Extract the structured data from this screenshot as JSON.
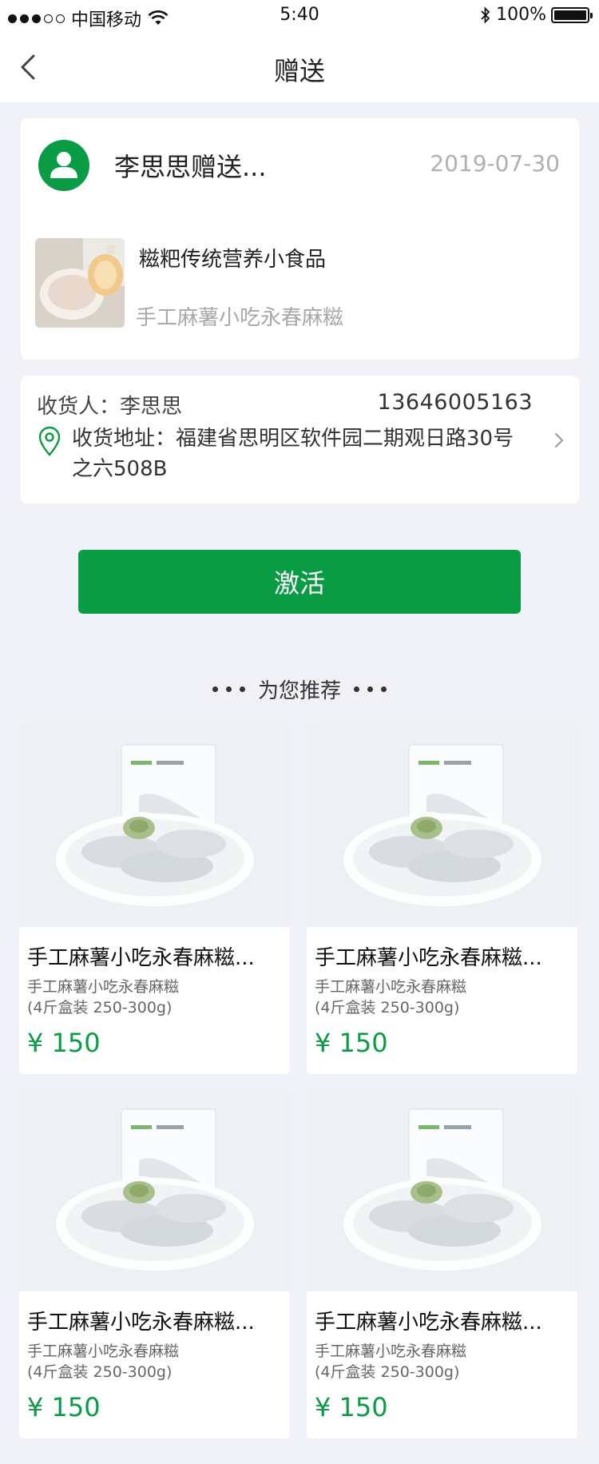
{
  "status_bar": {
    "carrier": "中国移动",
    "time": "5:40",
    "battery": "100%"
  },
  "nav": {
    "title": "赠送"
  },
  "gift": {
    "sender_text": "李思思赠送...",
    "date": "2019-07-30",
    "product_name": "糍粑传统营养小食品",
    "product_desc": "手工麻薯小吃永春麻糍"
  },
  "address": {
    "receiver": "收货人：李思思",
    "phone": "13646005163",
    "address_text": "收货地址：福建省思明区软件园二期观日路30号之六508B"
  },
  "actions": {
    "activate_label": "激活"
  },
  "recommend": {
    "heading": "为您推荐",
    "items": [
      {
        "title": "手工麻薯小吃永春麻糍...",
        "sub1": "手工麻薯小吃永春麻糍",
        "sub2": "(4斤盒装 250-300g)",
        "price": "¥ 150"
      },
      {
        "title": "手工麻薯小吃永春麻糍...",
        "sub1": "手工麻薯小吃永春麻糍",
        "sub2": "(4斤盒装 250-300g)",
        "price": "¥ 150"
      },
      {
        "title": "手工麻薯小吃永春麻糍...",
        "sub1": "手工麻薯小吃永春麻糍",
        "sub2": "(4斤盒装 250-300g)",
        "price": "¥ 150"
      },
      {
        "title": "手工麻薯小吃永春麻糍...",
        "sub1": "手工麻薯小吃永春麻糍",
        "sub2": "(4斤盒装 250-300g)",
        "price": "¥ 150"
      }
    ]
  },
  "icons": {
    "back": "chevron-left-icon",
    "wifi": "wifi-icon",
    "bluetooth": "bluetooth-icon",
    "battery": "battery-icon",
    "avatar": "user-icon",
    "location": "location-pin-icon",
    "chevron_right": "chevron-right-icon"
  },
  "colors": {
    "accent": "#0a9b45",
    "page_background": "#f1f2f7",
    "muted_text": "#a8a8a8"
  }
}
